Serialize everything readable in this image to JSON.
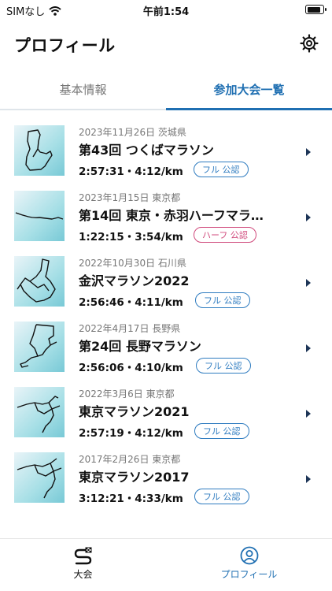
{
  "status_bar": {
    "carrier": "SIMなし",
    "time": "午前1:54",
    "battery_level": 0.9
  },
  "header": {
    "title": "プロフィール",
    "settings_icon": "gear-icon"
  },
  "tabs": [
    {
      "label": "基本情報",
      "active": false
    },
    {
      "label": "参加大会一覧",
      "active": true
    }
  ],
  "races": [
    {
      "date": "2023年11月26日",
      "prefecture": "茨城県",
      "name": "第43回 つくばマラソン",
      "stats": "2:57:31・4:12/km",
      "badge": "フル 公認",
      "badge_type": "full"
    },
    {
      "date": "2023年1月15日",
      "prefecture": "東京都",
      "name": "第14回 東京・赤羽ハーフマラ…",
      "stats": "1:22:15・3:54/km",
      "badge": "ハーフ 公認",
      "badge_type": "half"
    },
    {
      "date": "2022年10月30日",
      "prefecture": "石川県",
      "name": "金沢マラソン2022",
      "stats": "2:56:46・4:11/km",
      "badge": "フル 公認",
      "badge_type": "full"
    },
    {
      "date": "2022年4月17日",
      "prefecture": "長野県",
      "name": "第24回 長野マラソン",
      "stats": "2:56:06・4:10/km",
      "badge": "フル 公認",
      "badge_type": "full"
    },
    {
      "date": "2022年3月6日",
      "prefecture": "東京都",
      "name": "東京マラソン2021",
      "stats": "2:57:19・4:12/km",
      "badge": "フル 公認",
      "badge_type": "full"
    },
    {
      "date": "2017年2月26日",
      "prefecture": "東京都",
      "name": "東京マラソン2017",
      "stats": "3:12:21・4:33/km",
      "badge": "フル 公認",
      "badge_type": "full"
    }
  ],
  "bottom_nav": [
    {
      "label": "大会",
      "icon": "race-icon",
      "active": false
    },
    {
      "label": "プロフィール",
      "icon": "profile-icon",
      "active": true
    }
  ],
  "colors": {
    "accent": "#1f6fb2",
    "full_badge": "#2f7cc0",
    "half_badge": "#d04a7c",
    "chevron": "#1d3557"
  }
}
